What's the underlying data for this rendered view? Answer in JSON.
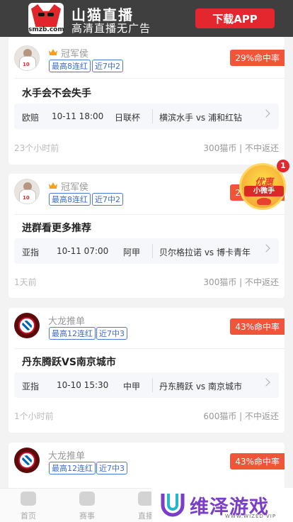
{
  "banner": {
    "logo_site": "smzb.com",
    "app_name": "山猫直播",
    "tagline": "高清直播无广告",
    "download_label": "下载APP"
  },
  "cards": [
    {
      "author": "冠军侯",
      "tags": [
        "最高8连红",
        "近7中2"
      ],
      "hit_rate": "29%命中率",
      "title": "水手会不会失手",
      "match": {
        "market": "欧赔",
        "datetime": "10-11 18:00",
        "league": "日联杯",
        "teams": "横滨水手 vs 浦和红钻"
      },
      "time_ago": "23个小时前",
      "price": "300猫币 | 不中返还"
    },
    {
      "author": "冠军侯",
      "tags": [
        "最高8连红",
        "近7中2"
      ],
      "hit_rate": "29%命中率",
      "title": "进群看更多推荐",
      "match": {
        "market": "亚指",
        "datetime": "10-11 07:00",
        "league": "阿甲",
        "teams": "贝尔格拉诺 vs 博卡青年"
      },
      "time_ago": "1天前",
      "price": "300猫币 | 不中返还"
    },
    {
      "author": "大龙推单",
      "tags": [
        "最高12连红",
        "近7中3"
      ],
      "hit_rate": "43%命中率",
      "title": "丹东腾跃VS南京城市",
      "match": {
        "market": "亚指",
        "datetime": "10-10 15:30",
        "league": "中甲",
        "teams": "丹东腾跃 vs 南京城市"
      },
      "time_ago": "1个小时前",
      "price": "600猫币 | 不中返还"
    },
    {
      "author": "大龙推单",
      "tags": [
        "最高12连红",
        "近7中3"
      ],
      "hit_rate": "43%命中率"
    }
  ],
  "promo": {
    "line1": "优惠",
    "line2": "小微手",
    "badge_count": "1"
  },
  "bottom_nav": [
    {
      "label": "首页",
      "icon": "home-icon"
    },
    {
      "label": "赛事",
      "icon": "trophy-icon"
    },
    {
      "label": "直播",
      "icon": "play-icon"
    }
  ],
  "watermark": {
    "text": "维泽游戏",
    "sub": "WWW.WIZED VIP"
  },
  "colors": {
    "accent_red": "#f0553a",
    "tag_blue": "#3d6cd0",
    "banner_bg": "#3f3f3f",
    "download_red": "#e4262f"
  }
}
